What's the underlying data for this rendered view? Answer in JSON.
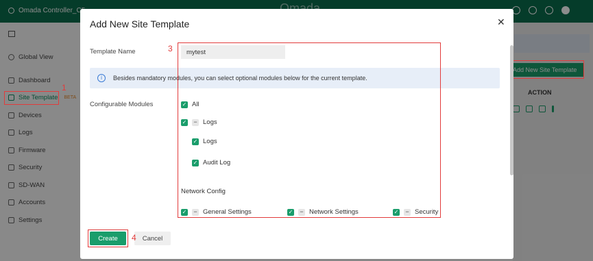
{
  "topbar": {
    "controller_name": "Omada Controller_C5",
    "brand": "Omada",
    "icons": [
      "help-icon",
      "refresh-icon",
      "theme-icon",
      "avatar"
    ]
  },
  "sidebar": {
    "global_view": "Global View",
    "items": [
      {
        "label": "Dashboard",
        "icon": "dashboard-icon"
      },
      {
        "label": "Site Template",
        "badge": "BETA",
        "icon": "site-template-icon"
      },
      {
        "label": "Devices",
        "icon": "devices-icon"
      },
      {
        "label": "Logs",
        "icon": "logs-icon"
      },
      {
        "label": "Firmware",
        "icon": "firmware-icon"
      },
      {
        "label": "Security",
        "icon": "security-icon"
      },
      {
        "label": "SD-WAN",
        "icon": "sdwan-icon"
      },
      {
        "label": "Accounts",
        "icon": "accounts-icon"
      },
      {
        "label": "Settings",
        "icon": "settings-icon"
      }
    ]
  },
  "background": {
    "add_button": "Add New Site Template",
    "action_header": "ACTION"
  },
  "annotations": [
    "1",
    "2",
    "3",
    "4"
  ],
  "modal": {
    "title": "Add New Site Template",
    "template_name_label": "Template Name",
    "template_name_value": "mytest",
    "info_text": "Besides mandatory modules, you can select optional modules below for the current template.",
    "configurable_label": "Configurable Modules",
    "modules": {
      "all": "All",
      "logs_group": "Logs",
      "logs": "Logs",
      "audit_log": "Audit Log",
      "network_config": "Network Config",
      "general_settings": "General Settings",
      "network_settings": "Network Settings",
      "security": "Security"
    },
    "create_label": "Create",
    "cancel_label": "Cancel"
  },
  "colors": {
    "brand": "#0a6d4e",
    "accent": "#1a9d6b",
    "annotation": "#e23b3b"
  }
}
